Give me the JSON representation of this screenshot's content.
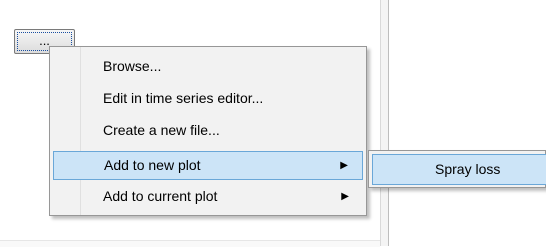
{
  "button": {
    "label": "..."
  },
  "context_menu": {
    "items": [
      {
        "label": "Browse...",
        "has_submenu": false,
        "highlighted": false
      },
      {
        "label": "Edit in time series editor...",
        "has_submenu": false,
        "highlighted": false
      },
      {
        "label": "Create a new file...",
        "has_submenu": false,
        "highlighted": false
      },
      {
        "label": "Add to new plot",
        "has_submenu": true,
        "highlighted": true
      },
      {
        "label": "Add to current plot",
        "has_submenu": true,
        "highlighted": false
      }
    ],
    "submenu_arrow": "▶"
  },
  "submenu": {
    "items": [
      {
        "label": "Spray loss",
        "highlighted": true
      }
    ]
  },
  "colors": {
    "highlight_bg": "#cce4f7",
    "highlight_border": "#6aa7d8",
    "menu_bg": "#f2f2f2"
  }
}
